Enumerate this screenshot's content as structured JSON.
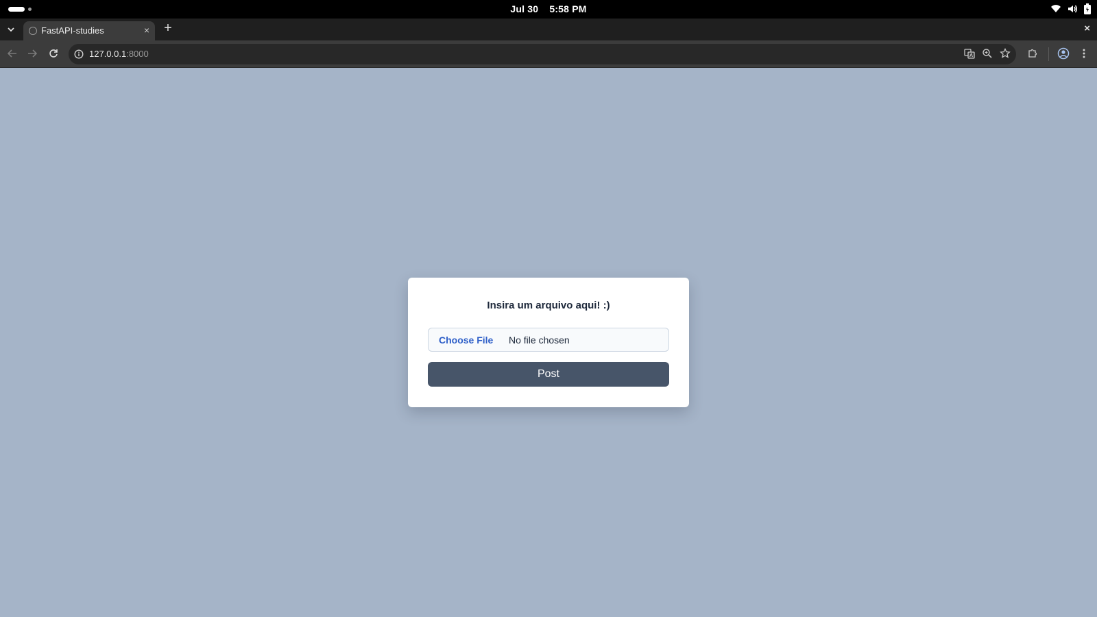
{
  "os": {
    "date": "Jul 30",
    "time": "5:58 PM",
    "status_icons": [
      "wifi-icon",
      "volume-icon",
      "battery-icon"
    ]
  },
  "browser": {
    "tab": {
      "title": "FastAPI-studies",
      "close": "×"
    },
    "new_tab": "+",
    "window_close": "×",
    "url": {
      "host": "127.0.0.1",
      "port": ":8000"
    },
    "omnibox_icons": [
      "translate-icon",
      "zoom-icon",
      "bookmark-star-icon"
    ],
    "toolbar_icons": [
      "extensions-icon",
      "profile-icon",
      "menu-icon"
    ]
  },
  "page": {
    "title": "Insira um arquivo aqui! :)",
    "file_input": {
      "button": "Choose File",
      "status": "No file chosen"
    },
    "submit": "Post",
    "colors": {
      "background": "#a5b4c8",
      "button": "#475569",
      "file_link": "#2d5ec8"
    }
  }
}
